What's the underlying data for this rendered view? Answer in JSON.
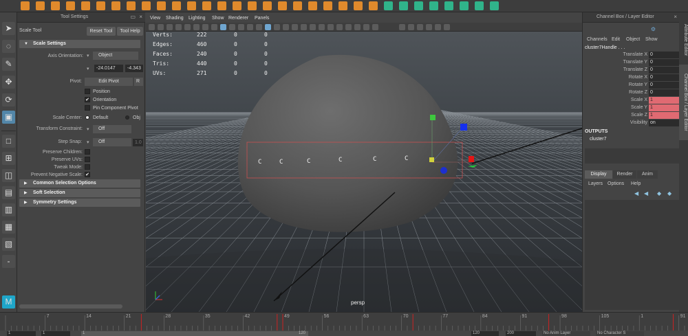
{
  "tool_settings": {
    "title": "Tool Settings",
    "tool_name": "Scale Tool",
    "reset_label": "Reset Tool",
    "help_label": "Tool Help",
    "section_scale": "Scale Settings",
    "axis_orientation_label": "Axis Orientation:",
    "axis_orientation_value": "Object",
    "field1": "-24.0147",
    "field2": "-4.343",
    "pivot_label": "Pivot:",
    "edit_pivot_label": "Edit Pivot",
    "reset_pivot_label": "R",
    "position_label": "Position",
    "orientation_label": "Orientation",
    "pin_pivot_label": "Pin Component Pivot",
    "scale_center_label": "Scale Center:",
    "default_label": "Default",
    "obj_label": "Obj",
    "transform_constraint_label": "Transform Constraint:",
    "transform_constraint_value": "Off",
    "step_snap_label": "Step Snap:",
    "step_snap_value": "Off",
    "step_snap_num": "1.0",
    "preserve_children_label": "Preserve Children:",
    "preserve_uvs_label": "Preserve UVs:",
    "tweak_mode_label": "Tweak Mode:",
    "prevent_negative_label": "Prevent Negative Scale:",
    "section_common": "Common Selection Options",
    "section_soft": "Soft Selection",
    "section_symmetry": "Symmetry Settings"
  },
  "viewport": {
    "menus": [
      "View",
      "Shading",
      "Lighting",
      "Show",
      "Renderer",
      "Panels"
    ],
    "hud": [
      {
        "label": "Verts:",
        "values": [
          "222",
          "0",
          "0"
        ]
      },
      {
        "label": "Edges:",
        "values": [
          "460",
          "0",
          "0"
        ]
      },
      {
        "label": "Faces:",
        "values": [
          "240",
          "0",
          "0"
        ]
      },
      {
        "label": "Tris:",
        "values": [
          "440",
          "0",
          "0"
        ]
      },
      {
        "label": "UVs:",
        "values": [
          "271",
          "0",
          "0"
        ]
      }
    ],
    "camera_label": "persp",
    "cluster_marker": "C"
  },
  "channel_box": {
    "title": "Channel Box / Layer Editor",
    "menus": [
      "Channels",
      "Edit",
      "Object",
      "Show"
    ],
    "node_name": "cluster7Handle . . .",
    "attributes": [
      {
        "label": "Translate X",
        "value": "0",
        "keyed": false
      },
      {
        "label": "Translate Y",
        "value": "0",
        "keyed": false
      },
      {
        "label": "Translate Z",
        "value": "0",
        "keyed": false
      },
      {
        "label": "Rotate X",
        "value": "0",
        "keyed": false
      },
      {
        "label": "Rotate Y",
        "value": "0",
        "keyed": false
      },
      {
        "label": "Rotate Z",
        "value": "0",
        "keyed": false
      },
      {
        "label": "Scale X",
        "value": "1",
        "keyed": true
      },
      {
        "label": "Scale Y",
        "value": "1",
        "keyed": true
      },
      {
        "label": "Scale Z",
        "value": "1",
        "keyed": true
      },
      {
        "label": "Visibility",
        "value": "on",
        "keyed": false
      }
    ],
    "outputs_label": "OUTPUTS",
    "output_node": "cluster7",
    "tabs": [
      "Display",
      "Render",
      "Anim"
    ],
    "layer_menus": [
      "Layers",
      "Options",
      "Help"
    ]
  },
  "side_tabs": [
    "Attribute Editor",
    "Channel Box / Layer Editor"
  ],
  "timeline": {
    "ticks": [
      "7",
      "14",
      "21",
      "28",
      "35",
      "42",
      "49",
      "56",
      "63",
      "70",
      "77",
      "84",
      "91",
      "98",
      "105",
      "1",
      "91",
      "98",
      "105",
      "1",
      "91"
    ],
    "range_fields": [
      "1",
      "1",
      "1",
      "120",
      "120",
      "200"
    ],
    "anim_layer": "No Anim Layer",
    "character_set": "No Character S"
  },
  "colors": {
    "accent": "#5286a8",
    "keyed": "#e06a72"
  }
}
